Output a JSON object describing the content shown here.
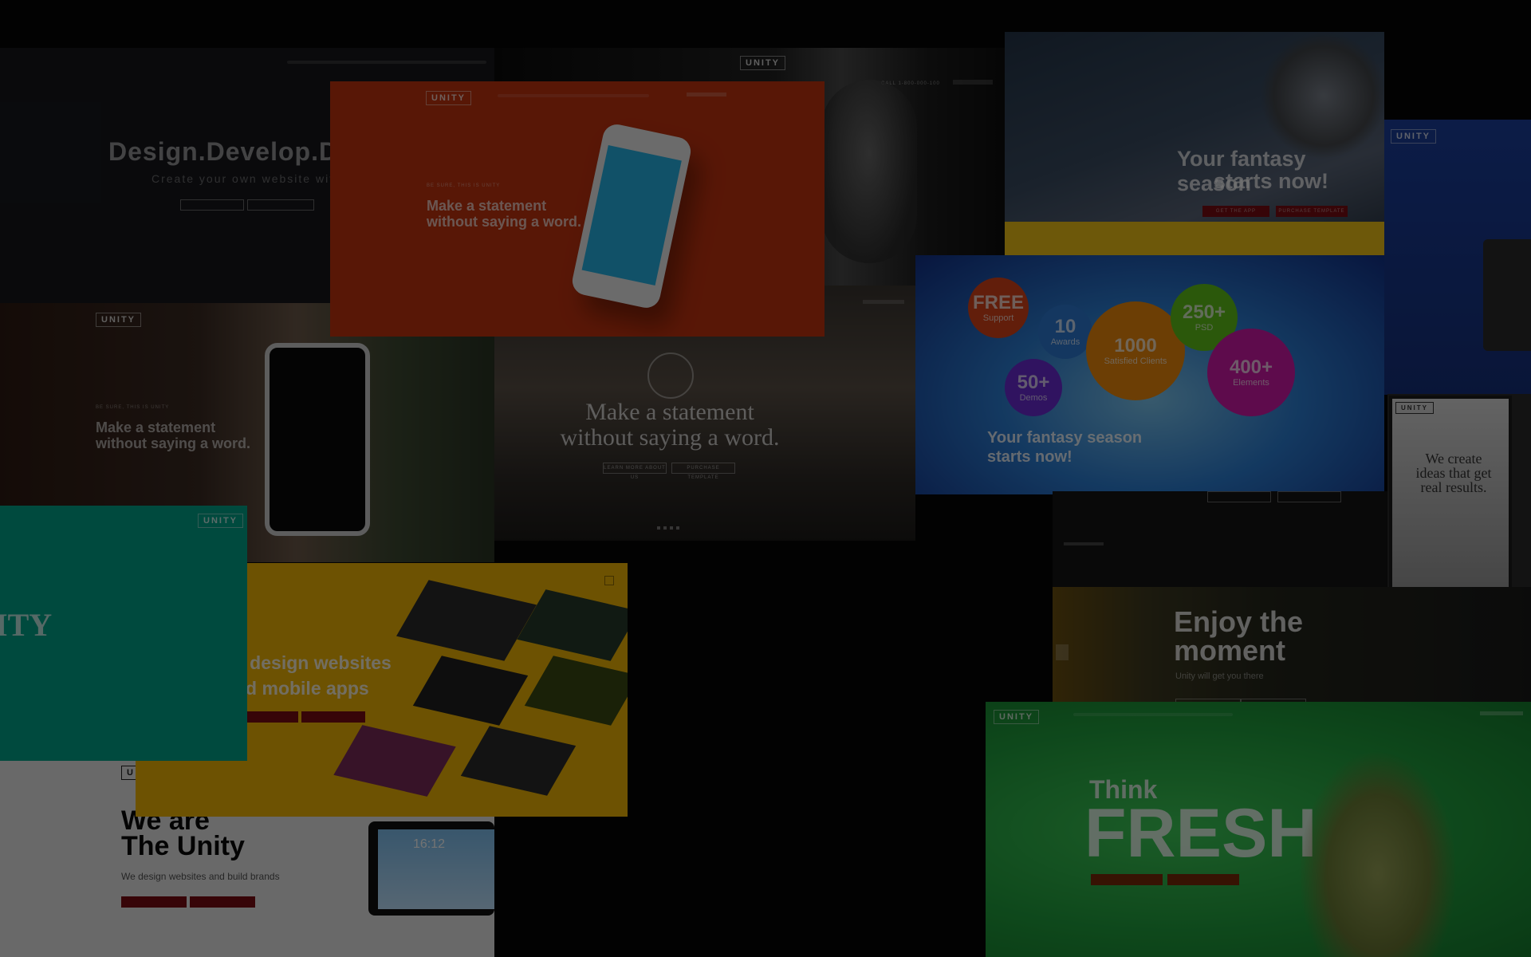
{
  "brand": "UNITY",
  "tiles": {
    "design": {
      "headline": "Design.Develop.De",
      "subline": "Create your own website with un"
    },
    "orange_phone": {
      "kicker": "BE SURE, THIS IS UNITY",
      "headline_line1": "Make a statement",
      "headline_line2": "without saying a word."
    },
    "portrait": {
      "contact": "CALL 1-800-000-100"
    },
    "football": {
      "headline_line1": "Your fantasy season",
      "headline_line2": "starts now!",
      "button1": "GET THE APP",
      "button2": "PURCHASE TEMPLATE"
    },
    "phone_hand": {
      "kicker": "BE SURE, THIS IS UNITY",
      "headline_line1": "Make a statement",
      "headline_line2": "without saying a word."
    },
    "mountain": {
      "headline_line1": "Make a statement",
      "headline_line2": "without saying a word.",
      "button1": "LEARN MORE ABOUT US",
      "button2": "PURCHASE TEMPLATE"
    },
    "bubbles": {
      "items": [
        {
          "num": "FREE",
          "label": "Support"
        },
        {
          "num": "10",
          "label": "Awards"
        },
        {
          "num": "1000",
          "label": "Satisfied Clients"
        },
        {
          "num": "250+",
          "label": "PSD"
        },
        {
          "num": "400+",
          "label": "Elements"
        },
        {
          "num": "50+",
          "label": "Demos"
        }
      ],
      "headline_line1": "Your fantasy season",
      "headline_line2": "starts now!"
    },
    "ideas": {
      "headline": "We create ideas that get real results."
    },
    "teal": {
      "text": "ITY"
    },
    "apps": {
      "headline_line1": "e design websites",
      "headline_line2": "nd mobile apps"
    },
    "moment": {
      "headline_line1": "Enjoy the",
      "headline_line2": "moment",
      "subline": "Unity will get you there"
    },
    "we_are": {
      "headline_line1": "We are",
      "headline_line2": "The Unity",
      "subline": "We design websites and build brands",
      "tablet_time": "16:12"
    },
    "fresh": {
      "line1": "Think",
      "line2": "FRESH"
    }
  },
  "colors": {
    "orange": "#c4330f",
    "yellow": "#f2b705",
    "green": "#1f9e3c",
    "teal": "#00a58a",
    "sky": "#2c7fd6",
    "red_button": "#c4141c"
  }
}
